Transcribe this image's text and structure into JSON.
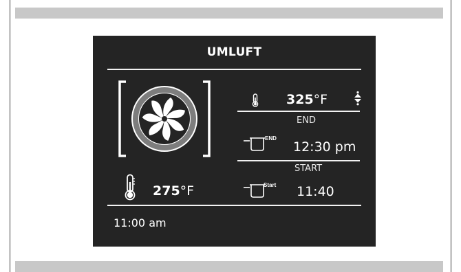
{
  "screen": {
    "mode_title": "UMLUFT",
    "oven_temp": {
      "value": "325",
      "unit": "°F"
    },
    "end": {
      "label": "END",
      "icon_label": "END",
      "time": "12:30 pm"
    },
    "start": {
      "label": "START",
      "icon_label": "Start",
      "time": "11:40"
    },
    "core_temp": {
      "value": "275",
      "unit": "°F"
    },
    "clock": "11:00 am"
  },
  "icons": {
    "fan": "fan-icon",
    "thermometer_small": "thermometer-icon",
    "thermometer_large": "core-temperature-probe-icon",
    "adjust": "up-down-arrows-icon",
    "end_pot": "end-pot-icon",
    "start_pot": "start-pot-icon"
  },
  "colors": {
    "screen_bg": "#242424",
    "foreground": "#ffffff",
    "fan_ring": "#808080",
    "side_bars": "#c8c8c8"
  }
}
